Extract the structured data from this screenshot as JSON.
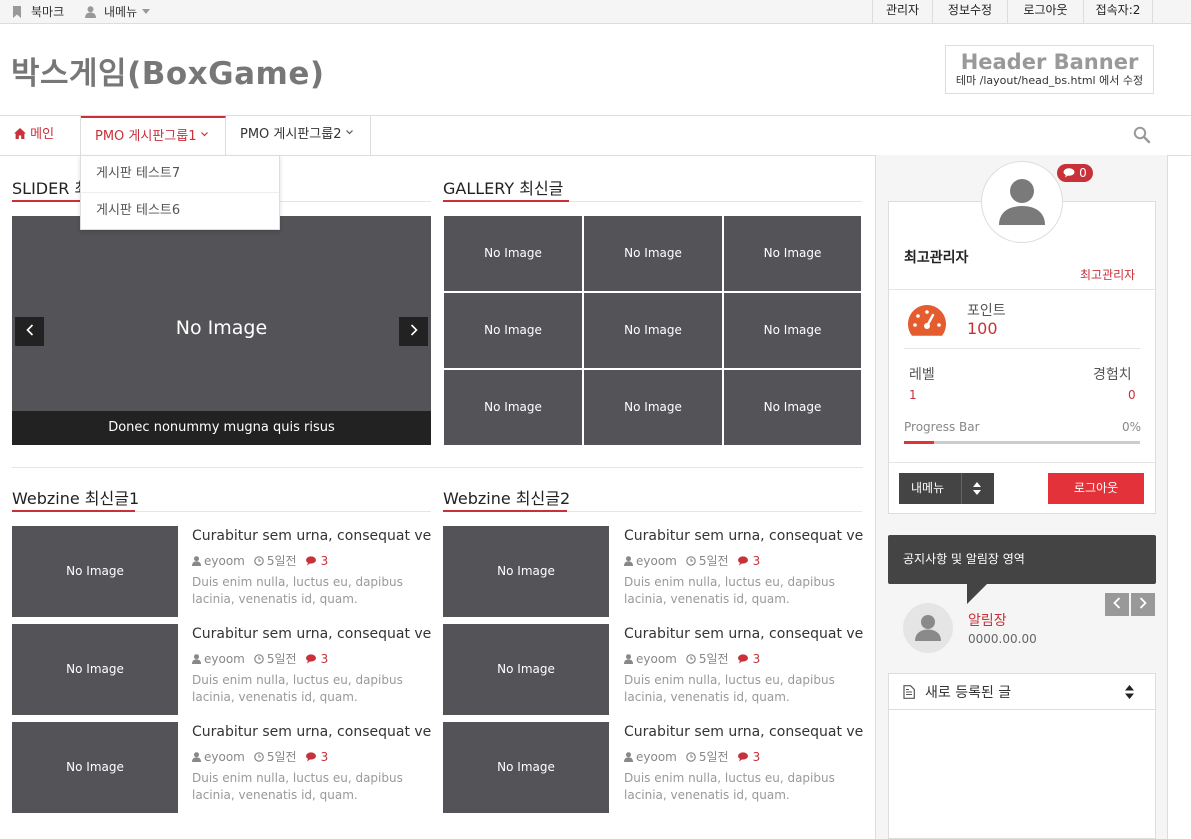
{
  "topbar": {
    "bookmark": "북마크",
    "my_menu": "내메뉴",
    "admin": "관리자",
    "edit_info": "정보수정",
    "logout": "로그아웃",
    "visitors": "접속자:2"
  },
  "header": {
    "site_title": "박스게임(BoxGame)",
    "banner_title": "Header Banner",
    "banner_note": "테마 /layout/head_bs.html 에서 수정"
  },
  "nav": {
    "home": "메인",
    "group1": "PMO 게시판그룹1",
    "group2": "PMO 게시판그룹2",
    "dropdown": [
      "게시판 테스트7",
      "게시판 테스트6"
    ]
  },
  "slider": {
    "title": "SLIDER 최",
    "no_image": "No Image",
    "caption": "Donec nonummy mugna quis risus"
  },
  "gallery": {
    "title": "GALLERY 최신글",
    "items": [
      "No Image",
      "No Image",
      "No Image",
      "No Image",
      "No Image",
      "No Image",
      "No Image",
      "No Image",
      "No Image"
    ]
  },
  "webzine1": {
    "title": "Webzine 최신글1",
    "posts": [
      {
        "image": "No Image",
        "title": "Curabitur sem urna, consequat ve",
        "author": "eyoom",
        "date": "5일전",
        "comments": "3",
        "desc": "Duis enim nulla, luctus eu, dapibus lacinia, venenatis id, quam."
      },
      {
        "image": "No Image",
        "title": "Curabitur sem urna, consequat ve",
        "author": "eyoom",
        "date": "5일전",
        "comments": "3",
        "desc": "Duis enim nulla, luctus eu, dapibus lacinia, venenatis id, quam."
      },
      {
        "image": "No Image",
        "title": "Curabitur sem urna, consequat ve",
        "author": "eyoom",
        "date": "5일전",
        "comments": "3",
        "desc": "Duis enim nulla, luctus eu, dapibus lacinia, venenatis id, quam."
      }
    ]
  },
  "webzine2": {
    "title": "Webzine 최신글2",
    "posts": [
      {
        "image": "No Image",
        "title": "Curabitur sem urna, consequat ve",
        "author": "eyoom",
        "date": "5일전",
        "comments": "3",
        "desc": "Duis enim nulla, luctus eu, dapibus lacinia, venenatis id, quam."
      },
      {
        "image": "No Image",
        "title": "Curabitur sem urna, consequat ve",
        "author": "eyoom",
        "date": "5일전",
        "comments": "3",
        "desc": "Duis enim nulla, luctus eu, dapibus lacinia, venenatis id, quam."
      },
      {
        "image": "No Image",
        "title": "Curabitur sem urna, consequat ve",
        "author": "eyoom",
        "date": "5일전",
        "comments": "3",
        "desc": "Duis enim nulla, luctus eu, dapibus lacinia, venenatis id, quam."
      }
    ]
  },
  "profile": {
    "message_count": "0",
    "nickname": "최고관리자",
    "level_name": "최고관리자",
    "point_label": "포인트",
    "point_value": "100",
    "level_label": "레벨",
    "level_value": "1",
    "exp_label": "경험치",
    "exp_value": "0",
    "progress_label": "Progress Bar",
    "progress_text": "0%",
    "progress_value": 0,
    "my_menu_button": "내메뉴",
    "logout_button": "로그아웃"
  },
  "notice": {
    "text": "공지사항 및 알림장 영역",
    "item_title": "알림장",
    "item_date": "0000.00.00"
  },
  "new_posts": {
    "title": "새로 등록된 글"
  },
  "colors": {
    "accent": "#c8313a",
    "logout_button": "#e3323a",
    "placeholder": "#545357",
    "dark": "#444444"
  }
}
